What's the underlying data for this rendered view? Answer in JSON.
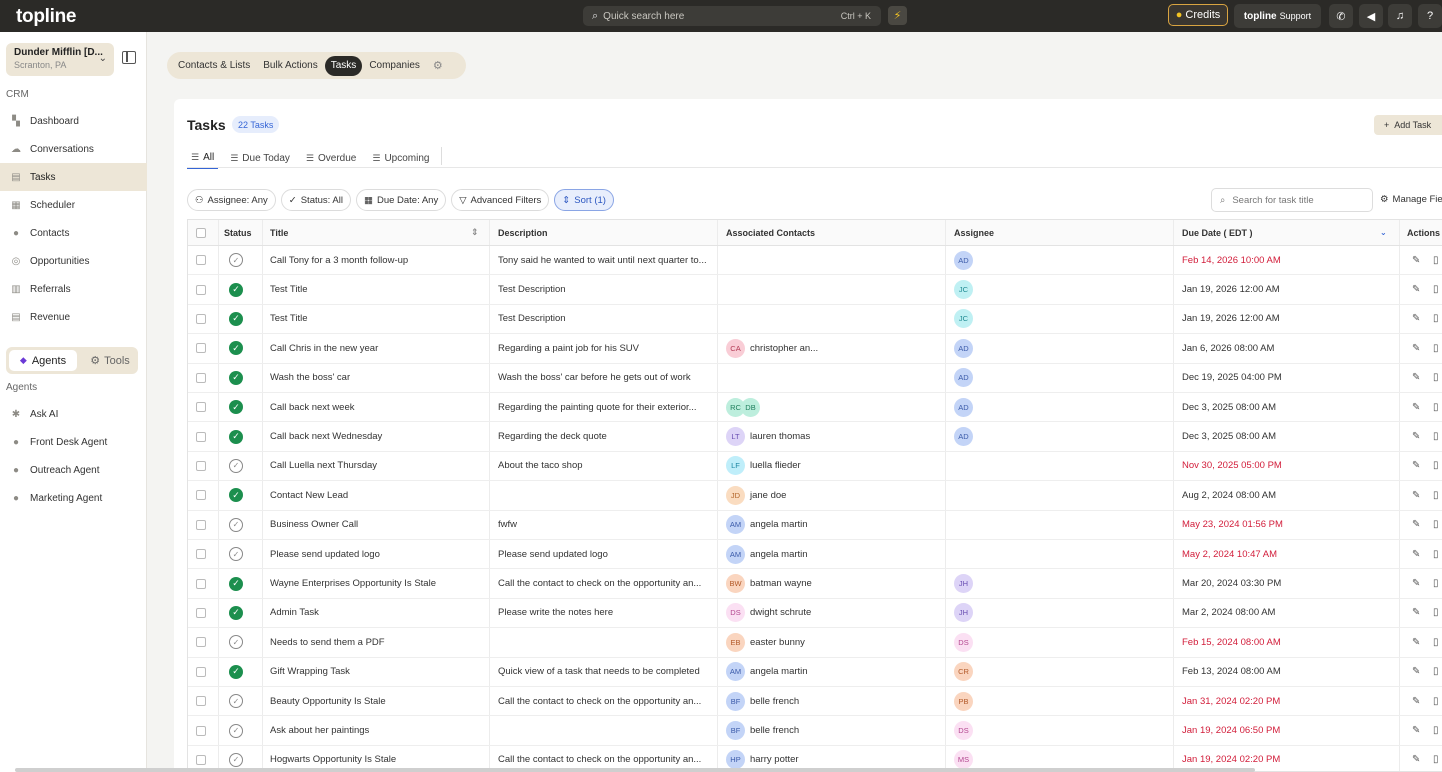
{
  "app": {
    "logo": "topline"
  },
  "topbar": {
    "search_placeholder": "Quick search here",
    "search_shortcut": "Ctrl + K",
    "credits_label": "Credits",
    "support_brand": "topline",
    "support_label": "Support"
  },
  "sidebar": {
    "org_name": "Dunder Mifflin [D...",
    "org_location": "Scranton, PA",
    "section_crm": "CRM",
    "nav": [
      {
        "label": "Dashboard",
        "icon": "dashboard-icon",
        "glyph": "▚"
      },
      {
        "label": "Conversations",
        "icon": "conversations-icon",
        "glyph": "☁"
      },
      {
        "label": "Tasks",
        "icon": "tasks-icon",
        "glyph": "▤"
      },
      {
        "label": "Scheduler",
        "icon": "calendar-icon",
        "glyph": "▦"
      },
      {
        "label": "Contacts",
        "icon": "person-icon",
        "glyph": "●"
      },
      {
        "label": "Opportunities",
        "icon": "target-icon",
        "glyph": "◎"
      },
      {
        "label": "Referrals",
        "icon": "referrals-icon",
        "glyph": "▥"
      },
      {
        "label": "Revenue",
        "icon": "revenue-icon",
        "glyph": "▤"
      }
    ],
    "toggle_agents": "Agents",
    "toggle_tools": "Tools",
    "section_agents": "Agents",
    "agents": [
      {
        "label": "Ask AI",
        "icon": "sparkle-icon",
        "glyph": "✱"
      },
      {
        "label": "Front Desk Agent",
        "icon": "agent-icon",
        "glyph": "●"
      },
      {
        "label": "Outreach Agent",
        "icon": "agent-icon",
        "glyph": "●"
      },
      {
        "label": "Marketing Agent",
        "icon": "team-icon",
        "glyph": "●"
      }
    ]
  },
  "module_tabs": [
    "Contacts & Lists",
    "Bulk Actions",
    "Tasks",
    "Companies"
  ],
  "tasks": {
    "title": "Tasks",
    "count": "22 Tasks",
    "add_label": "Add Task",
    "subtabs": [
      "All",
      "Due Today",
      "Overdue",
      "Upcoming"
    ],
    "filters": [
      "Assignee: Any",
      "Status: All",
      "Due Date: Any",
      "Advanced Filters",
      "Sort (1)"
    ],
    "search_placeholder": "Search for task title",
    "manage_label": "Manage Fie",
    "columns": {
      "status": "Status",
      "title": "Title",
      "description": "Description",
      "contacts": "Associated Contacts",
      "assignee": "Assignee",
      "due": "Due Date ( EDT )",
      "actions": "Actions"
    },
    "rows": [
      {
        "done": false,
        "title": "Call Tony for a 3 month follow-up",
        "desc": "Tony said he wanted to wait until next quarter to...",
        "contacts": [],
        "contact_name": "",
        "assignee": {
          "i": "AD",
          "c": "#c3d4f7",
          "t": "#3b5ba9"
        },
        "due": "Feb 14, 2026 10:00 AM",
        "overdue": true
      },
      {
        "done": true,
        "title": "Test Title",
        "desc": "Test Description",
        "contacts": [],
        "contact_name": "",
        "assignee": {
          "i": "JC",
          "c": "#bff0f3",
          "t": "#1f8b93"
        },
        "due": "Jan 19, 2026 12:00 AM",
        "overdue": false
      },
      {
        "done": true,
        "title": "Test Title",
        "desc": "Test Description",
        "contacts": [],
        "contact_name": "",
        "assignee": {
          "i": "JC",
          "c": "#bff0f3",
          "t": "#1f8b93"
        },
        "due": "Jan 19, 2026 12:00 AM",
        "overdue": false
      },
      {
        "done": true,
        "title": "Call Chris in the new year",
        "desc": "Regarding a paint job for his SUV",
        "contacts": [
          {
            "i": "CA",
            "c": "#f9cdd6",
            "t": "#b33a55"
          }
        ],
        "contact_name": "christopher an...",
        "assignee": {
          "i": "AD",
          "c": "#c3d4f7",
          "t": "#3b5ba9"
        },
        "due": "Jan 6, 2026 08:00 AM",
        "overdue": false
      },
      {
        "done": true,
        "title": "Wash the boss' car",
        "desc": "Wash the boss' car before he gets out of work",
        "contacts": [],
        "contact_name": "",
        "assignee": {
          "i": "AD",
          "c": "#c3d4f7",
          "t": "#3b5ba9"
        },
        "due": "Dec 19, 2025 04:00 PM",
        "overdue": false
      },
      {
        "done": true,
        "title": "Call back next week",
        "desc": "Regarding the painting quote for their exterior...",
        "contacts": [
          {
            "i": "RC",
            "c": "#bdeedd",
            "t": "#1f7f5d"
          },
          {
            "i": "DB",
            "c": "#bdeedd",
            "t": "#1f7f5d"
          }
        ],
        "contact_name": "",
        "assignee": {
          "i": "AD",
          "c": "#c3d4f7",
          "t": "#3b5ba9"
        },
        "due": "Dec 3, 2025 08:00 AM",
        "overdue": false
      },
      {
        "done": true,
        "title": "Call back next Wednesday",
        "desc": "Regarding the deck quote",
        "contacts": [
          {
            "i": "LT",
            "c": "#ddd4f7",
            "t": "#6a4fb3"
          }
        ],
        "contact_name": "lauren thomas",
        "assignee": {
          "i": "AD",
          "c": "#c3d4f7",
          "t": "#3b5ba9"
        },
        "due": "Dec 3, 2025 08:00 AM",
        "overdue": false
      },
      {
        "done": false,
        "title": "Call Luella next Thursday",
        "desc": "About the taco shop",
        "contacts": [
          {
            "i": "LF",
            "c": "#bfeefa",
            "t": "#1c86a3"
          }
        ],
        "contact_name": "luella flieder",
        "assignee": null,
        "due": "Nov 30, 2025 05:00 PM",
        "overdue": true
      },
      {
        "done": true,
        "title": "Contact New Lead",
        "desc": "",
        "contacts": [
          {
            "i": "JD",
            "c": "#fadcc0",
            "t": "#b3662a"
          }
        ],
        "contact_name": "jane doe",
        "assignee": null,
        "due": "Aug 2, 2024 08:00 AM",
        "overdue": false
      },
      {
        "done": false,
        "title": "Business Owner Call",
        "desc": "fwfw",
        "contacts": [
          {
            "i": "AM",
            "c": "#c3d4f7",
            "t": "#3b5ba9"
          }
        ],
        "contact_name": "angela martin",
        "assignee": null,
        "due": "May 23, 2024 01:56 PM",
        "overdue": true
      },
      {
        "done": false,
        "title": "Please send updated logo",
        "desc": "Please send updated logo",
        "contacts": [
          {
            "i": "AM",
            "c": "#c3d4f7",
            "t": "#3b5ba9"
          }
        ],
        "contact_name": "angela martin",
        "assignee": null,
        "due": "May 2, 2024 10:47 AM",
        "overdue": true
      },
      {
        "done": true,
        "title": "Wayne Enterprises Opportunity Is Stale",
        "desc": "Call the contact to check on the opportunity an...",
        "contacts": [
          {
            "i": "BW",
            "c": "#fad5bf",
            "t": "#b35a2a"
          }
        ],
        "contact_name": "batman wayne",
        "assignee": {
          "i": "JH",
          "c": "#ddd4f7",
          "t": "#6a4fb3"
        },
        "due": "Mar 20, 2024 03:30 PM",
        "overdue": false
      },
      {
        "done": true,
        "title": "Admin Task",
        "desc": "Please write the notes here",
        "contacts": [
          {
            "i": "DS",
            "c": "#fbe0f3",
            "t": "#b3468f"
          }
        ],
        "contact_name": "dwight schrute",
        "assignee": {
          "i": "JH",
          "c": "#ddd4f7",
          "t": "#6a4fb3"
        },
        "due": "Mar 2, 2024 08:00 AM",
        "overdue": false
      },
      {
        "done": false,
        "title": "Needs to send them a PDF",
        "desc": "",
        "contacts": [
          {
            "i": "EB",
            "c": "#fad5bf",
            "t": "#b35a2a"
          }
        ],
        "contact_name": "easter bunny",
        "assignee": {
          "i": "DS",
          "c": "#fbe0f3",
          "t": "#b3468f"
        },
        "due": "Feb 15, 2024 08:00 AM",
        "overdue": true
      },
      {
        "done": true,
        "title": "Gift Wrapping Task",
        "desc": "Quick view of a task that needs to be completed",
        "contacts": [
          {
            "i": "AM",
            "c": "#c3d4f7",
            "t": "#3b5ba9"
          }
        ],
        "contact_name": "angela martin",
        "assignee": {
          "i": "CR",
          "c": "#fad5bf",
          "t": "#b35a2a"
        },
        "due": "Feb 13, 2024 08:00 AM",
        "overdue": false
      },
      {
        "done": false,
        "title": "Beauty Opportunity Is Stale",
        "desc": "Call the contact to check on the opportunity an...",
        "contacts": [
          {
            "i": "BF",
            "c": "#c3d4f7",
            "t": "#3b5ba9"
          }
        ],
        "contact_name": "belle french",
        "assignee": {
          "i": "PB",
          "c": "#fad5bf",
          "t": "#b35a2a"
        },
        "due": "Jan 31, 2024 02:20 PM",
        "overdue": true
      },
      {
        "done": false,
        "title": "Ask about her paintings",
        "desc": "",
        "contacts": [
          {
            "i": "BF",
            "c": "#c3d4f7",
            "t": "#3b5ba9"
          }
        ],
        "contact_name": "belle french",
        "assignee": {
          "i": "DS",
          "c": "#fbe0f3",
          "t": "#b3468f"
        },
        "due": "Jan 19, 2024 06:50 PM",
        "overdue": true
      },
      {
        "done": false,
        "title": "Hogwarts Opportunity Is Stale",
        "desc": "Call the contact to check on the opportunity an...",
        "contacts": [
          {
            "i": "HP",
            "c": "#c3d4f7",
            "t": "#3b5ba9"
          }
        ],
        "contact_name": "harry potter",
        "assignee": {
          "i": "MS",
          "c": "#fbe0f3",
          "t": "#b3468f"
        },
        "due": "Jan 19, 2024 02:20 PM",
        "overdue": true
      }
    ]
  }
}
